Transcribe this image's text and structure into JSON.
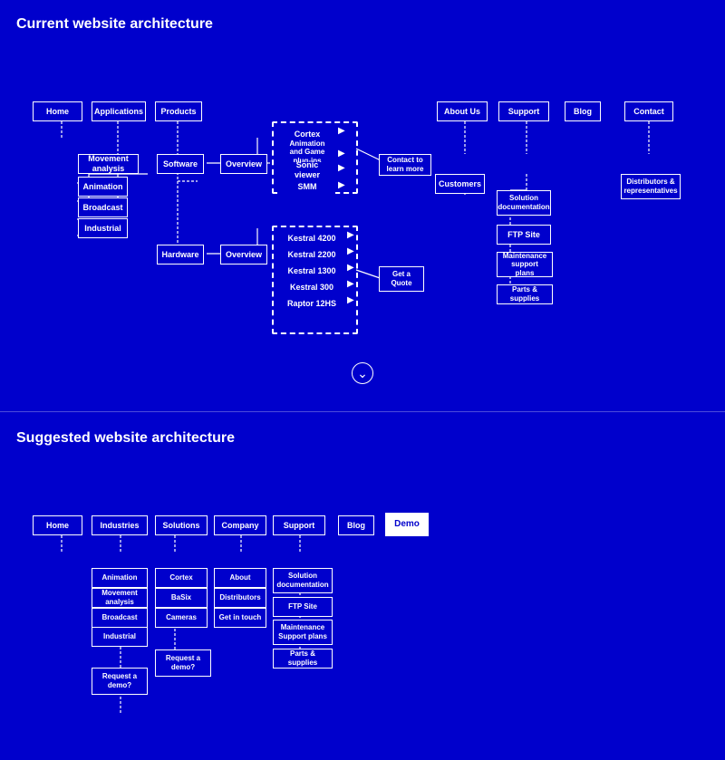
{
  "section1": {
    "title": "Current website architecture",
    "nodes": {
      "home": "Home",
      "applications": "Applications",
      "products": "Products",
      "aboutUs": "About Us",
      "support": "Support",
      "blog": "Blog",
      "contact": "Contact",
      "movementAnalysis": "Movement analysis",
      "animation": "Animation",
      "broadcast": "Broadcast",
      "industrial": "Industrial",
      "software": "Software",
      "overview1": "Overview",
      "cortex": "Cortex",
      "animationPlugin": "Animation and Game plug-ins",
      "sonicViewer": "Sonic viewer",
      "smm": "SMM",
      "contactToLearnMore": "Contact to learn more",
      "customers": "Customers",
      "solutionDocumentation": "Solution documentation",
      "ftpSite": "FTP Site",
      "maintenanceSupportPlans": "Maintenance support plans",
      "partsSupplies": "Parts & supplies",
      "distributorsReps": "Distributors & representatives",
      "hardware": "Hardware",
      "overview2": "Overview",
      "kestral4200": "Kestral 4200",
      "kestral2200": "Kestral 2200",
      "kestral1300": "Kestral 1300",
      "kestral300": "Kestral 300",
      "raptor12hs": "Raptor 12HS",
      "getAQuote": "Get a Quote"
    }
  },
  "expandButton": "⌄",
  "section2": {
    "title": "Suggested website architecture",
    "nodes": {
      "home": "Home",
      "industries": "Industries",
      "solutions": "Solutions",
      "company": "Company",
      "support": "Support",
      "blog": "Blog",
      "demo": "Demo",
      "animation": "Animation",
      "movementAnalysis": "Movement analysis",
      "broadcast": "Broadcast",
      "industrial": "Industrial",
      "requestDemo1": "Request a demo?",
      "cortex": "Cortex",
      "basix": "BaSix",
      "cameras": "Cameras",
      "requestDemo2": "Request a demo?",
      "about": "About",
      "distributors": "Distributors",
      "getInTouch": "Get in touch",
      "solutionDocumentation": "Solution documentation",
      "ftpSite": "FTP Site",
      "maintenanceSupportPlans": "Maintenance Support plans",
      "partsSupplies": "Parts & supplies"
    }
  }
}
